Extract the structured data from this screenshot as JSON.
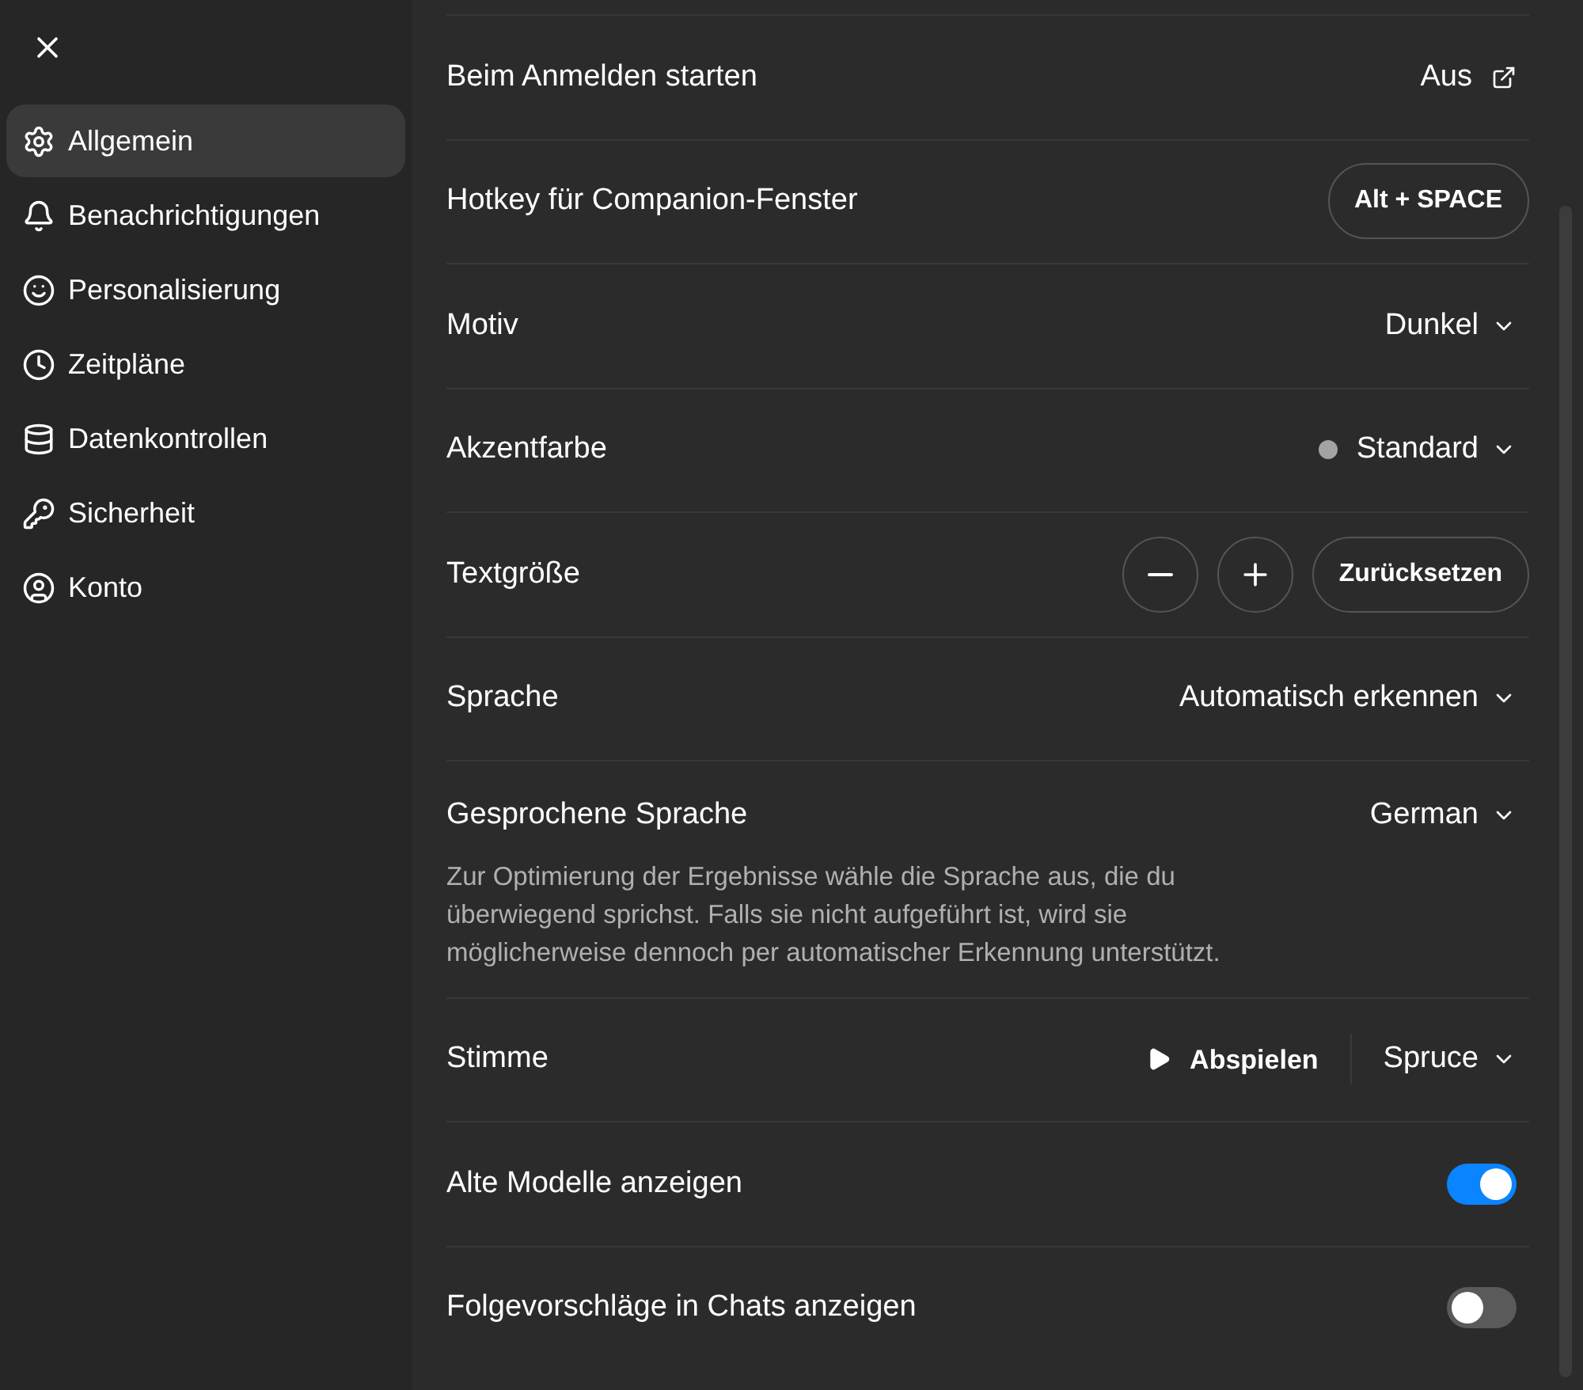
{
  "sidebar": {
    "items": [
      {
        "label": "Allgemein",
        "selected": true
      },
      {
        "label": "Benachrichtigungen",
        "selected": false
      },
      {
        "label": "Personalisierung",
        "selected": false
      },
      {
        "label": "Zeitpläne",
        "selected": false
      },
      {
        "label": "Datenkontrollen",
        "selected": false
      },
      {
        "label": "Sicherheit",
        "selected": false
      },
      {
        "label": "Konto",
        "selected": false
      }
    ]
  },
  "settings": [
    {
      "kind": "link",
      "label": "Beim Anmelden starten",
      "value": "Aus"
    },
    {
      "kind": "hotkey",
      "label": "Hotkey für Companion-Fenster",
      "value": "Alt + SPACE"
    },
    {
      "kind": "dropdown",
      "label": "Motiv",
      "value": "Dunkel"
    },
    {
      "kind": "dropdown",
      "label": "Akzentfarbe",
      "value": "Standard",
      "color": "#a3a3a3"
    },
    {
      "kind": "textsize",
      "label": "Textgröße",
      "value": "Zurücksetzen"
    },
    {
      "kind": "dropdown",
      "label": "Sprache",
      "value": "Automatisch erkennen"
    },
    {
      "kind": "dropdown",
      "label": "Gesprochene Sprache",
      "value": "German",
      "description": "Zur Optimierung der Ergebnisse wähle die Sprache aus, die du überwiegend sprichst. Falls sie nicht aufgeführt ist, wird sie möglicherweise dennoch per automatischer Erkennung unterstützt."
    },
    {
      "kind": "voice",
      "label": "Stimme",
      "play": "Abspielen",
      "value": "Spruce"
    },
    {
      "kind": "toggle",
      "label": "Alte Modelle anzeigen",
      "on": true
    },
    {
      "kind": "toggle",
      "label": "Folgevorschläge in Chats anzeigen",
      "on": false
    }
  ]
}
